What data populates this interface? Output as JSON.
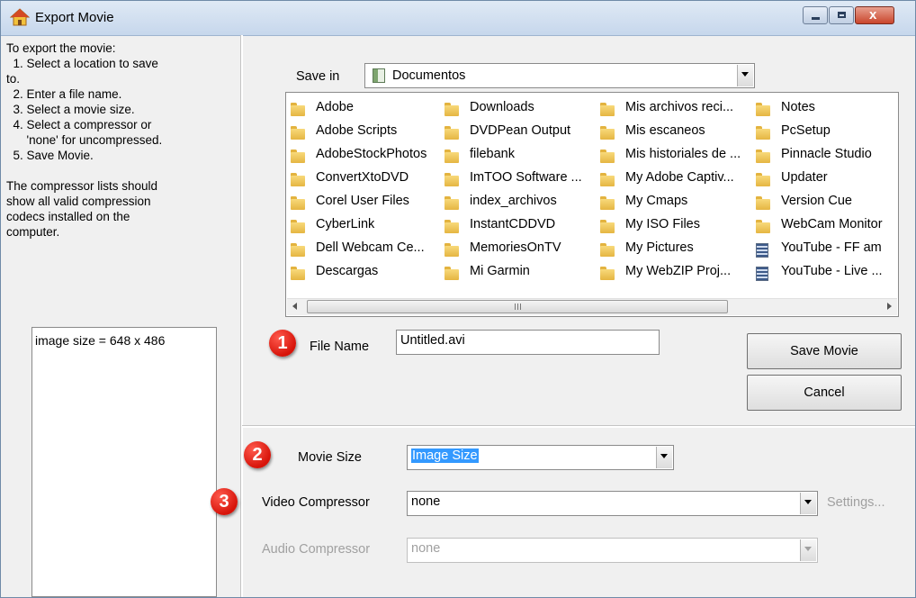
{
  "window": {
    "title": "Export Movie",
    "buttons": {
      "minimize": "minimize",
      "maximize": "maximize",
      "close": "x"
    }
  },
  "instructions": {
    "lines": [
      "To export the movie:",
      "  1. Select a location to save",
      "to.",
      "  2. Enter a file name.",
      "  3. Select a movie size.",
      "  4. Select a compressor or",
      "      'none' for uncompressed.",
      "  5. Save Movie.",
      "",
      "The compressor lists should",
      "show all valid compression",
      "codecs installed on the",
      "computer."
    ]
  },
  "info_box": {
    "text": "image size = 648 x 486"
  },
  "save_in": {
    "label": "Save in",
    "value": "Documentos"
  },
  "file_columns": [
    [
      {
        "name": "Adobe",
        "icon": "folder-icon"
      },
      {
        "name": "Adobe Scripts",
        "icon": "folder-icon"
      },
      {
        "name": "AdobeStockPhotos",
        "icon": "folder-icon"
      },
      {
        "name": "ConvertXtoDVD",
        "icon": "folder-icon"
      },
      {
        "name": "Corel User Files",
        "icon": "folder-icon"
      },
      {
        "name": "CyberLink",
        "icon": "folder-icon"
      },
      {
        "name": "Dell Webcam Ce...",
        "icon": "folder-icon"
      },
      {
        "name": "Descargas",
        "icon": "folder-icon"
      }
    ],
    [
      {
        "name": "Downloads",
        "icon": "folder-icon"
      },
      {
        "name": "DVDPean Output",
        "icon": "folder-icon"
      },
      {
        "name": "filebank",
        "icon": "folder-icon"
      },
      {
        "name": "ImTOO Software ...",
        "icon": "folder-icon"
      },
      {
        "name": "index_archivos",
        "icon": "folder-icon"
      },
      {
        "name": "InstantCDDVD",
        "icon": "folder-icon"
      },
      {
        "name": "MemoriesOnTV",
        "icon": "folder-icon"
      },
      {
        "name": "Mi Garmin",
        "icon": "folder-icon"
      }
    ],
    [
      {
        "name": "Mis archivos reci...",
        "icon": "folder-icon"
      },
      {
        "name": "Mis escaneos",
        "icon": "folder-icon"
      },
      {
        "name": "Mis historiales de ...",
        "icon": "folder-icon"
      },
      {
        "name": "My Adobe Captiv...",
        "icon": "folder-icon"
      },
      {
        "name": "My Cmaps",
        "icon": "folder-icon"
      },
      {
        "name": "My ISO Files",
        "icon": "folder-icon"
      },
      {
        "name": "My Pictures",
        "icon": "folder-icon"
      },
      {
        "name": "My WebZIP Proj...",
        "icon": "folder-icon"
      }
    ],
    [
      {
        "name": "Notes",
        "icon": "folder-icon"
      },
      {
        "name": "PcSetup",
        "icon": "folder-icon"
      },
      {
        "name": "Pinnacle Studio",
        "icon": "folder-icon"
      },
      {
        "name": "Updater",
        "icon": "folder-icon"
      },
      {
        "name": "Version Cue",
        "icon": "folder-icon"
      },
      {
        "name": "WebCam Monitor",
        "icon": "folder-icon"
      },
      {
        "name": "YouTube - FF am",
        "icon": "video-file-icon"
      },
      {
        "name": "YouTube - Live ...",
        "icon": "video-file-icon"
      }
    ]
  ],
  "steps": {
    "one": "1",
    "two": "2",
    "three": "3"
  },
  "file_name": {
    "label": "File Name",
    "value": "Untitled.avi"
  },
  "buttons": {
    "save_movie": "Save Movie",
    "cancel": "Cancel"
  },
  "movie_size": {
    "label": "Movie Size",
    "value": "Image Size"
  },
  "video_compressor": {
    "label": "Video Compressor",
    "value": "none",
    "settings_label": "Settings..."
  },
  "audio_compressor": {
    "label": "Audio Compressor",
    "value": "none"
  },
  "colors": {
    "badge": "#d7140a",
    "selection": "#3399ff"
  }
}
